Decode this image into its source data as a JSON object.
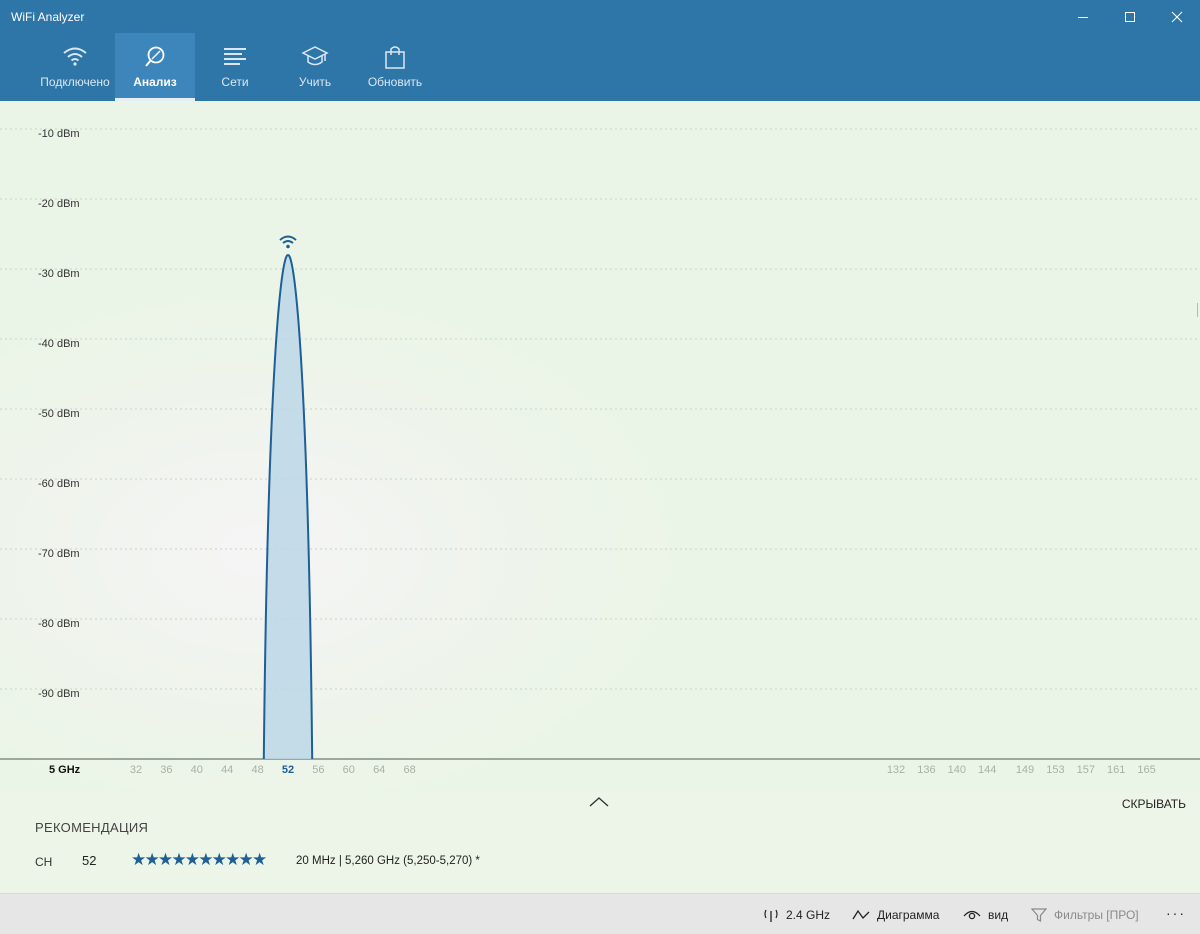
{
  "window": {
    "title": "WiFi Analyzer"
  },
  "nav": {
    "tabs": [
      {
        "label": "Подключено",
        "icon": "wifi-icon",
        "active": false
      },
      {
        "label": "Анализ",
        "icon": "analyze-icon",
        "active": true
      },
      {
        "label": "Сети",
        "icon": "networks-list-icon",
        "active": false
      },
      {
        "label": "Учить",
        "icon": "graduation-cap-icon",
        "active": false
      },
      {
        "label": "Обновить",
        "icon": "shopping-bag-icon",
        "active": false
      }
    ]
  },
  "colors": {
    "accent": "#2f76a8",
    "signal": "#1e5f96",
    "signal_fill": "#bcd6e8"
  },
  "chart_data": {
    "type": "area",
    "band_label": "5 GHz",
    "y_ticks": [
      "-10 dBm",
      "-20 dBm",
      "-30 dBm",
      "-40 dBm",
      "-50 dBm",
      "-60 dBm",
      "-70 dBm",
      "-80 dBm",
      "-90 dBm"
    ],
    "ylim": [
      -100,
      -5
    ],
    "grid": true,
    "channel_labels": [
      "32",
      "36",
      "40",
      "44",
      "48",
      "52",
      "56",
      "60",
      "64",
      "68",
      "132",
      "136",
      "140",
      "144",
      "149",
      "153",
      "157",
      "161",
      "165"
    ],
    "highlighted_channel": "52",
    "series": [
      {
        "channel": 52,
        "signal_dbm": -28,
        "width_mhz": 20
      }
    ]
  },
  "recommendation": {
    "title": "РЕКОМЕНДАЦИЯ",
    "ch_label": "CH",
    "channel": "52",
    "rating": 10,
    "stars_text": "★★★★★★★★★★",
    "info": "20 MHz | 5,260 GHz  (5,250-5,270) *"
  },
  "panel": {
    "hide_label": "СКРЫВАТЬ"
  },
  "statusbar": {
    "band": "2.4 GHz",
    "diagram": "Диаграмма",
    "view": "вид",
    "filters": "Фильтры [ПРО]",
    "more": "···"
  }
}
